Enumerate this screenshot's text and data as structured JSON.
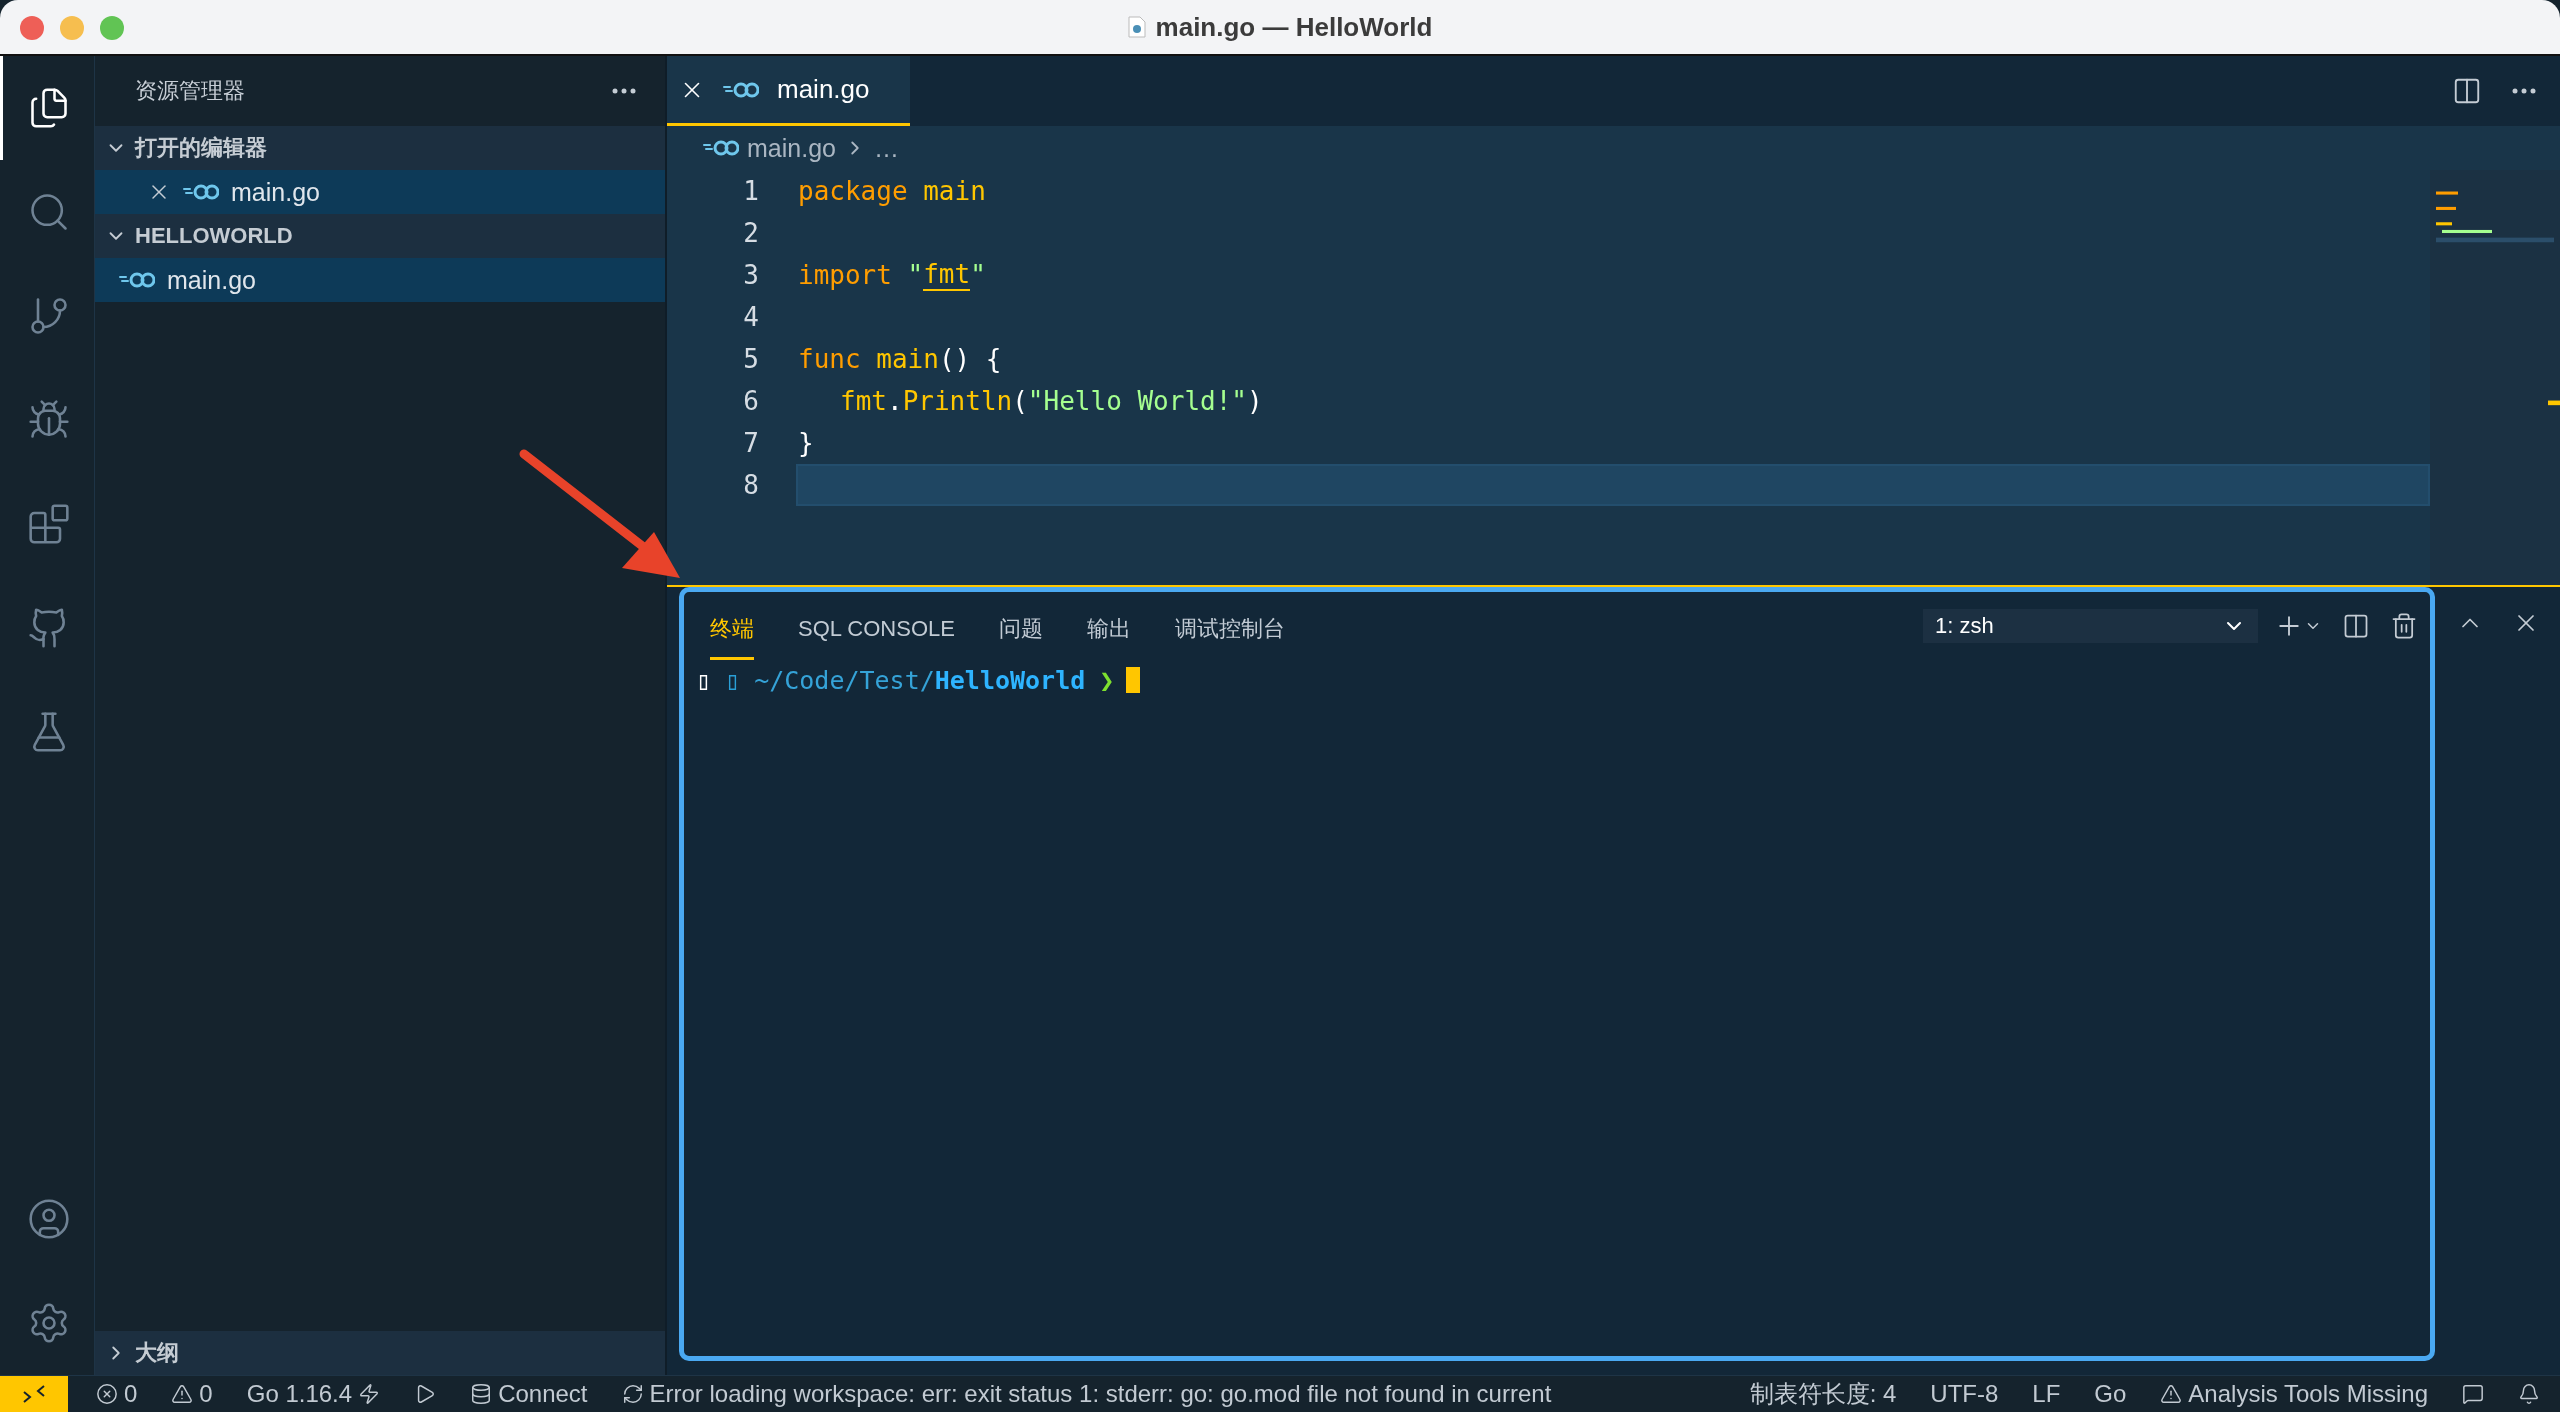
{
  "window": {
    "title": "main.go — HelloWorld"
  },
  "activity_bar": {
    "top": [
      {
        "kind": "explorer",
        "selected": true
      },
      {
        "kind": "search",
        "selected": false
      },
      {
        "kind": "source-control",
        "selected": false
      },
      {
        "kind": "run",
        "selected": false
      },
      {
        "kind": "extensions",
        "selected": false
      },
      {
        "kind": "github",
        "selected": false
      },
      {
        "kind": "testing",
        "selected": false
      }
    ],
    "bottom": [
      {
        "kind": "account",
        "selected": false
      },
      {
        "kind": "settings",
        "selected": false
      }
    ]
  },
  "sidebar": {
    "title": "资源管理器",
    "sections": [
      {
        "title": "打开的编辑器",
        "expanded": true,
        "items": [
          {
            "label": "main.go",
            "selected": true,
            "closable": true
          }
        ]
      },
      {
        "title": "HELLOWORLD",
        "expanded": true,
        "items": [
          {
            "label": "main.go",
            "selected": true,
            "closable": false
          }
        ]
      },
      {
        "title": "大纲",
        "expanded": false
      }
    ]
  },
  "editor": {
    "tabs": [
      {
        "label": "main.go",
        "selected": true
      }
    ],
    "breadcrumb": [
      "main.go",
      "…"
    ],
    "lines": [
      {
        "number": "1",
        "current": false,
        "tokens": [
          {
            "kind": "keyword",
            "text": "package"
          },
          {
            "kind": "name",
            "text": "main"
          }
        ]
      },
      {
        "number": "2",
        "current": false
      },
      {
        "number": "3",
        "current": false,
        "tokens": [
          {
            "kind": "keyword",
            "text": "import"
          },
          {
            "kind": "string",
            "text": "\""
          },
          {
            "kind": "link",
            "text": "fmt"
          },
          {
            "kind": "string",
            "text": "\""
          }
        ]
      },
      {
        "number": "4",
        "current": false
      },
      {
        "number": "5",
        "current": false,
        "tokens": [
          {
            "kind": "keyword",
            "text": "func"
          },
          {
            "kind": "name",
            "text": "main"
          },
          {
            "kind": "plain",
            "text": "() {"
          }
        ]
      },
      {
        "number": "6",
        "current": false,
        "indent": true,
        "tokens": [
          {
            "kind": "name",
            "text": "fmt"
          },
          {
            "kind": "plain",
            "text": "."
          },
          {
            "kind": "name",
            "text": "Println"
          },
          {
            "kind": "plain",
            "text": "("
          },
          {
            "kind": "string",
            "text": "\"Hello World!\""
          },
          {
            "kind": "plain",
            "text": ")"
          }
        ]
      },
      {
        "number": "7",
        "current": false,
        "tokens": [
          {
            "kind": "plain",
            "text": "}"
          }
        ]
      },
      {
        "number": "8",
        "current": true
      }
    ]
  },
  "panel": {
    "tabs": [
      {
        "label": "终端",
        "selected": true
      },
      {
        "label": "SQL CONSOLE",
        "selected": false
      },
      {
        "label": "问题",
        "selected": false
      },
      {
        "label": "输出",
        "selected": false
      },
      {
        "label": "调试控制台",
        "selected": false
      }
    ],
    "terminal_select": "1: zsh",
    "prompt": [
      {
        "kind": "glyph",
        "text": "▯"
      },
      {
        "kind": "icon-glyph",
        "text": "▯"
      },
      {
        "kind": "path",
        "text": "~/Code/Test/"
      },
      {
        "kind": "dir",
        "text": "HelloWorld"
      },
      {
        "kind": "arrow",
        "text": "❯"
      }
    ]
  },
  "status_bar": {
    "left": [
      {
        "kind": "remote"
      },
      {
        "kind": "errors",
        "text": "0"
      },
      {
        "kind": "warnings",
        "text": "0"
      },
      {
        "kind": "go-version",
        "text": "Go 1.16.4"
      },
      {
        "kind": "run"
      },
      {
        "kind": "database",
        "text": "Connect"
      },
      {
        "kind": "sync",
        "text": "Error loading workspace: err: exit status 1: stderr: go: go.mod file not found in current"
      }
    ],
    "right": [
      {
        "kind": "text",
        "text": "制表符长度: 4"
      },
      {
        "kind": "text",
        "text": "UTF-8"
      },
      {
        "kind": "text",
        "text": "LF"
      },
      {
        "kind": "text",
        "text": "Go"
      },
      {
        "kind": "warnings",
        "text": "Analysis Tools Missing"
      },
      {
        "kind": "feedback"
      },
      {
        "kind": "bell"
      }
    ]
  }
}
